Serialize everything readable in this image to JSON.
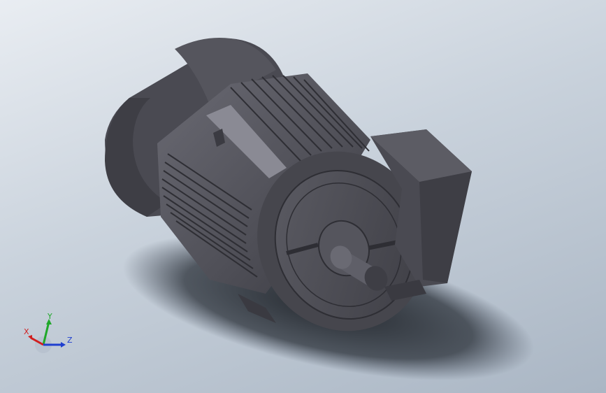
{
  "viewport": {
    "background_top": "#e9edf2",
    "background_bottom": "#aab6c4",
    "model_color": "#4f4f57"
  },
  "triad": {
    "x_label": "X",
    "y_label": "Y",
    "z_label": "Z",
    "x_color": "#d11f1f",
    "y_color": "#1fa82a",
    "z_color": "#1f3fcf"
  }
}
